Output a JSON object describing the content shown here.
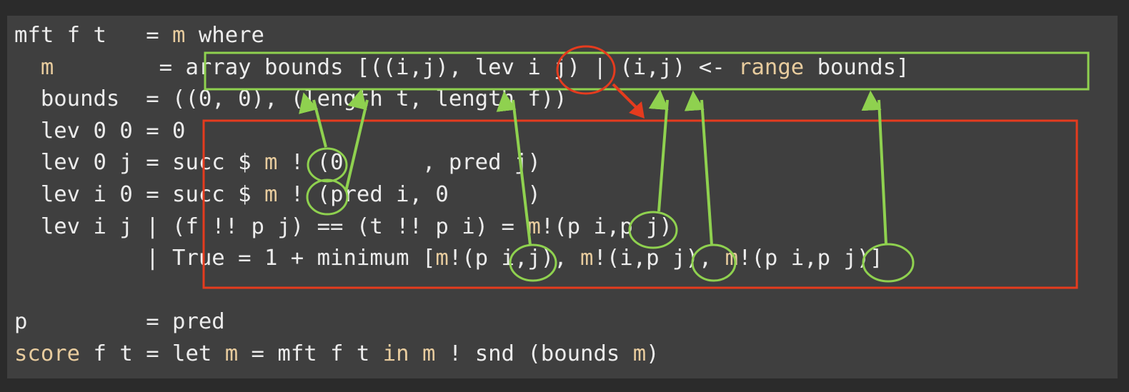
{
  "code_lines": [
    [
      {
        "t": "mft f t   = ",
        "k": "tx"
      },
      {
        "t": "m",
        "k": "kw"
      },
      {
        "t": " where",
        "k": "tx"
      }
    ],
    [
      {
        "t": "  ",
        "k": "tx"
      },
      {
        "t": "m",
        "k": "kw"
      },
      {
        "t": "        = array bounds [((i,j), lev i j) | (i,j) <- ",
        "k": "tx"
      },
      {
        "t": "range",
        "k": "kw"
      },
      {
        "t": " bounds]",
        "k": "tx"
      }
    ],
    [
      {
        "t": "  bounds  = ((0, 0), (length t, length f))",
        "k": "tx"
      }
    ],
    [
      {
        "t": "  lev 0 0 = 0",
        "k": "tx"
      }
    ],
    [
      {
        "t": "  lev 0 j = succ $ ",
        "k": "tx"
      },
      {
        "t": "m",
        "k": "kw"
      },
      {
        "t": " ! (0      , pred j)",
        "k": "tx"
      }
    ],
    [
      {
        "t": "  lev i 0 = succ $ ",
        "k": "tx"
      },
      {
        "t": "m",
        "k": "kw"
      },
      {
        "t": " ! (pred i, 0      )",
        "k": "tx"
      }
    ],
    [
      {
        "t": "  lev i j | (f !! p j) == (t !! p i) = ",
        "k": "tx"
      },
      {
        "t": "m",
        "k": "kw"
      },
      {
        "t": "!(p i,p j)",
        "k": "tx"
      }
    ],
    [
      {
        "t": "          | True = 1 + minimum [",
        "k": "tx"
      },
      {
        "t": "m",
        "k": "kw"
      },
      {
        "t": "!(p i,j), ",
        "k": "tx"
      },
      {
        "t": "m",
        "k": "kw"
      },
      {
        "t": "!(i,p j), ",
        "k": "tx"
      },
      {
        "t": "m",
        "k": "kw"
      },
      {
        "t": "!(p i,p j)]",
        "k": "tx"
      }
    ],
    [],
    [
      {
        "t": "p         = pred",
        "k": "tx"
      }
    ],
    [
      {
        "t": "score",
        "k": "kw"
      },
      {
        "t": " f t = let ",
        "k": "tx"
      },
      {
        "t": "m",
        "k": "kw"
      },
      {
        "t": " = mft f t ",
        "k": "tx"
      },
      {
        "t": "in",
        "k": "kw"
      },
      {
        "t": " ",
        "k": "tx"
      },
      {
        "t": "m",
        "k": "kw"
      },
      {
        "t": " ! snd (bounds ",
        "k": "tx"
      },
      {
        "t": "m",
        "k": "kw"
      },
      {
        "t": ")",
        "k": "tx"
      }
    ]
  ],
  "colors": {
    "page_background": "#2b2b2b",
    "panel_background": "#3f3f3f",
    "code_text": "#ececec",
    "keyword_text": "#e8cc9e",
    "green_annotation": "#8fd14f",
    "red_annotation": "#e53b1e"
  }
}
